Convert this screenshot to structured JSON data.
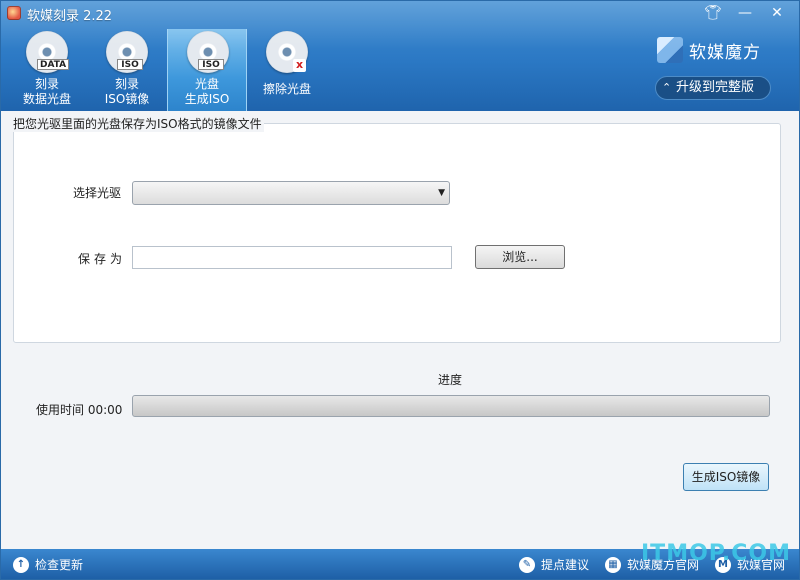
{
  "window": {
    "title": "软媒刻录 2.22"
  },
  "toolbar": {
    "items": [
      {
        "tag": "DATA",
        "label1": "刻录",
        "label2": "数据光盘"
      },
      {
        "tag": "ISO",
        "label1": "刻录",
        "label2": "ISO镜像"
      },
      {
        "tag": "ISO",
        "label1": "光盘",
        "label2": "生成ISO"
      },
      {
        "tag": "x",
        "label1": "擦除光盘",
        "label2": ""
      }
    ]
  },
  "brand": {
    "name": "软媒魔方",
    "upgrade_label": "升级到完整版"
  },
  "main": {
    "group_title": "把您光驱里面的光盘保存为ISO格式的镜像文件",
    "drive_label": "选择光驱",
    "drive_value": "",
    "save_label": "保存为",
    "save_value": "",
    "browse_label": "浏览...",
    "progress_label": "进度",
    "progress_value": 0,
    "time_label": "使用时间 00:00",
    "make_label": "生成ISO镜像"
  },
  "status": {
    "update": "检查更新",
    "suggest": "提点建议",
    "site": "软媒魔方官网",
    "official": "软媒官网",
    "official_icon_letter": "M"
  },
  "watermark": "ITMOP.COM",
  "icons": {
    "app": "burner-app-icon",
    "skin": "shirt-icon",
    "minimize": "minimize-icon",
    "close": "close-icon"
  }
}
